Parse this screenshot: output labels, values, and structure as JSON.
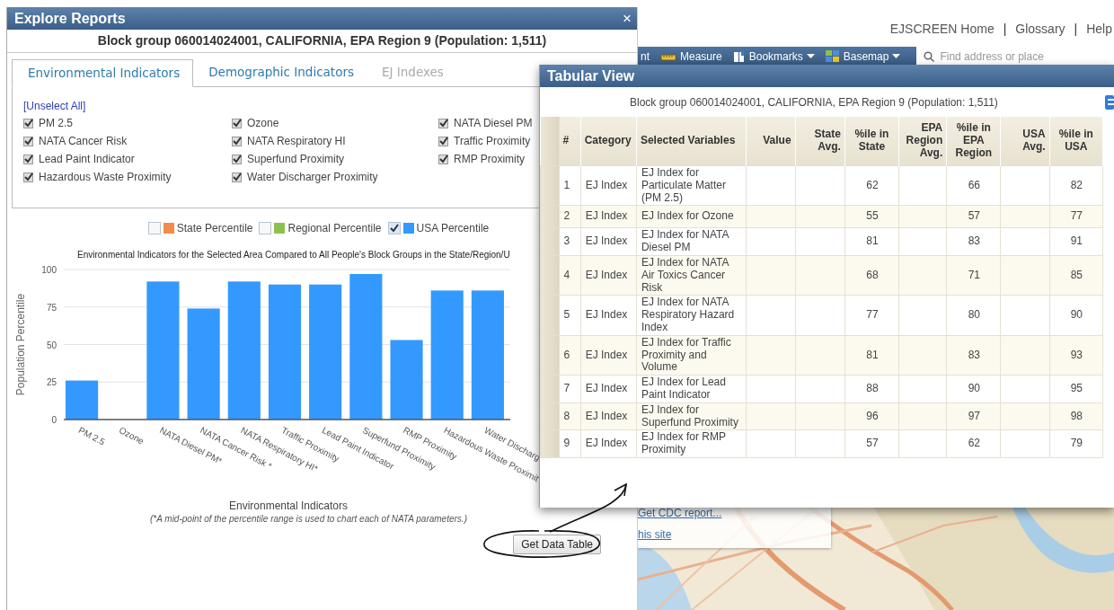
{
  "header_nav": [
    {
      "kind": "link",
      "text": "EJSCREEN Home"
    },
    {
      "kind": "separator",
      "text": "|"
    },
    {
      "kind": "link",
      "text": "Glossary"
    },
    {
      "kind": "separator",
      "text": "|"
    },
    {
      "kind": "link",
      "text": "Help"
    }
  ],
  "map_toolbar": {
    "items": [
      {
        "kind": "text",
        "label": "nt",
        "dropdown": false
      },
      {
        "kind": "measure",
        "label": "Measure",
        "dropdown": false
      },
      {
        "kind": "bookmarks",
        "label": "Bookmarks",
        "dropdown": true
      },
      {
        "kind": "basemap",
        "label": "Basemap",
        "dropdown": true
      }
    ],
    "search": {
      "placeholder": "Find address or place"
    }
  },
  "map": {
    "kind": "picture",
    "popup_links": [
      "Get CDC report...",
      "his site"
    ]
  },
  "explore_reports": {
    "title": "Explore Reports",
    "close": "×",
    "subtitle": "Block group 060014024001, CALIFORNIA, EPA Region 9 (Population: 1,511)",
    "tabs": [
      {
        "label": "Environmental Indicators",
        "selected": true,
        "disabled": false
      },
      {
        "label": "Demographic Indicators",
        "selected": false,
        "disabled": false
      },
      {
        "label": "EJ Indexes",
        "selected": false,
        "disabled": true
      }
    ],
    "unselect_all": "[Unselect All]",
    "indicators": [
      {
        "label": "PM 2.5",
        "checked": true
      },
      {
        "label": "Ozone",
        "checked": true
      },
      {
        "label": "NATA Diesel PM",
        "checked": true
      },
      {
        "label": "NATA Cancer Risk",
        "checked": true
      },
      {
        "label": "NATA Respiratory HI",
        "checked": true
      },
      {
        "label": "Traffic Proximity",
        "checked": true
      },
      {
        "label": "Lead Paint Indicator",
        "checked": true
      },
      {
        "label": "Superfund Proximity",
        "checked": true
      },
      {
        "label": "RMP Proximity",
        "checked": true
      },
      {
        "label": "Hazardous Waste Proximity",
        "checked": true
      },
      {
        "label": "Water Discharger Proximity",
        "checked": true
      }
    ],
    "legend": [
      {
        "label": "State Percentile",
        "checked": false,
        "color": "#f58a4b"
      },
      {
        "label": "Regional Percentile",
        "checked": false,
        "color": "#8cc152"
      },
      {
        "label": "USA Percentile",
        "checked": true,
        "color": "#3399ff"
      }
    ],
    "chart_data": {
      "type": "bar",
      "title": "Environmental Indicators for the Selected Area Compared to All People's Block Groups in the State/Region/U",
      "xlabel": "Environmental Indicators",
      "ylabel": "Population Percentile",
      "categories": [
        "PM 2.5",
        "Ozone",
        "NATA Diesel PM*",
        "NATA Cancer Risk *",
        "NATA Respiratory HI*",
        "Traffic Proximity",
        "Lead Paint Indicator",
        "Superfund Proximity",
        "RMP Proximity",
        "Hazardous Waste Proximit",
        "Water Discharg"
      ],
      "series": [
        {
          "color": "#3399ff",
          "values": [
            26,
            null,
            92,
            74,
            92,
            90,
            90,
            97,
            53,
            86,
            86
          ]
        }
      ],
      "ylim": [
        0,
        100
      ],
      "yticks": [
        0,
        25,
        50,
        75,
        100
      ],
      "grid": true
    },
    "note": "(*A mid-point of the percentile range is used to chart each of NATA parameters.)",
    "button": "Get Data Table"
  },
  "tabular_view": {
    "title": "Tabular View",
    "subtitle": "Block group 060014024001, CALIFORNIA, EPA Region 9 (Population: 1,511)",
    "table": {
      "columns": [
        "#",
        "Category",
        "Selected Variables",
        "Value",
        "State Avg.",
        "%ile in State",
        "EPA Region Avg.",
        "%ile in EPA Region",
        "USA Avg.",
        "%ile in USA"
      ],
      "rows": [
        {
          "num": "1",
          "category": "EJ Index",
          "variable": "EJ Index for Particulate Matter (PM 2.5)",
          "pct_state": "62",
          "pct_region": "66",
          "pct_usa": "82"
        },
        {
          "num": "2",
          "category": "EJ Index",
          "variable": "EJ Index for Ozone",
          "pct_state": "55",
          "pct_region": "57",
          "pct_usa": "77"
        },
        {
          "num": "3",
          "category": "EJ Index",
          "variable": "EJ Index for NATA Diesel PM",
          "pct_state": "81",
          "pct_region": "83",
          "pct_usa": "91"
        },
        {
          "num": "4",
          "category": "EJ Index",
          "variable": "EJ Index for NATA Air Toxics Cancer Risk",
          "pct_state": "68",
          "pct_region": "71",
          "pct_usa": "85"
        },
        {
          "num": "5",
          "category": "EJ Index",
          "variable": "EJ Index for NATA Respiratory Hazard Index",
          "pct_state": "77",
          "pct_region": "80",
          "pct_usa": "90"
        },
        {
          "num": "6",
          "category": "EJ Index",
          "variable": "EJ Index for Traffic Proximity and Volume",
          "pct_state": "81",
          "pct_region": "83",
          "pct_usa": "93"
        },
        {
          "num": "7",
          "category": "EJ Index",
          "variable": "EJ Index for Lead Paint Indicator",
          "pct_state": "88",
          "pct_region": "90",
          "pct_usa": "95"
        },
        {
          "num": "8",
          "category": "EJ Index",
          "variable": "EJ Index for Superfund Proximity",
          "pct_state": "96",
          "pct_region": "97",
          "pct_usa": "98"
        },
        {
          "num": "9",
          "category": "EJ Index",
          "variable": "EJ Index for RMP Proximity",
          "pct_state": "57",
          "pct_region": "62",
          "pct_usa": "79"
        }
      ]
    }
  }
}
